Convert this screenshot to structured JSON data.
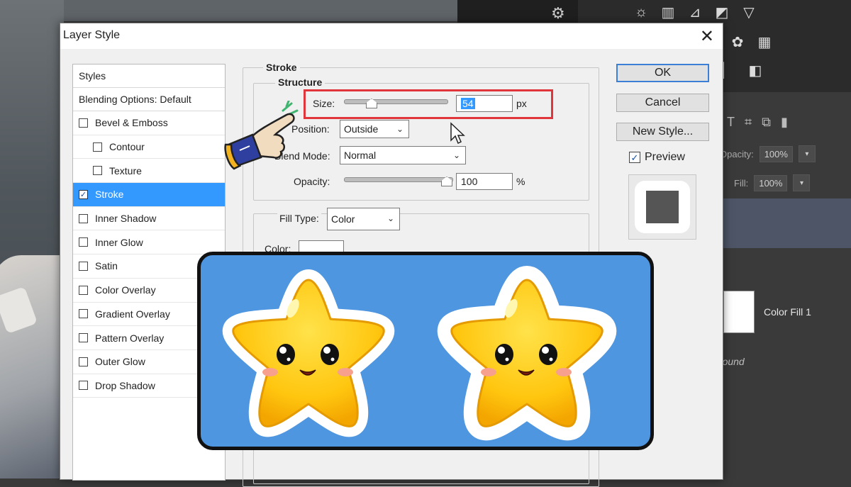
{
  "dialog": {
    "title": "Layer Style",
    "close_glyph": "✕"
  },
  "styles_panel": {
    "header": "Styles",
    "blending_options": "Blending Options: Default",
    "items": [
      {
        "label": "Bevel & Emboss",
        "checked": false,
        "sub": false
      },
      {
        "label": "Contour",
        "checked": false,
        "sub": true
      },
      {
        "label": "Texture",
        "checked": false,
        "sub": true
      },
      {
        "label": "Stroke",
        "checked": true,
        "sub": false,
        "selected": true
      },
      {
        "label": "Inner Shadow",
        "checked": false,
        "sub": false
      },
      {
        "label": "Inner Glow",
        "checked": false,
        "sub": false
      },
      {
        "label": "Satin",
        "checked": false,
        "sub": false
      },
      {
        "label": "Color Overlay",
        "checked": false,
        "sub": false
      },
      {
        "label": "Gradient Overlay",
        "checked": false,
        "sub": false
      },
      {
        "label": "Pattern Overlay",
        "checked": false,
        "sub": false
      },
      {
        "label": "Outer Glow",
        "checked": false,
        "sub": false
      },
      {
        "label": "Drop Shadow",
        "checked": false,
        "sub": false
      }
    ]
  },
  "stroke": {
    "section_title": "Stroke",
    "structure_title": "Structure",
    "size_label": "Size:",
    "size_value": "54",
    "size_unit": "px",
    "position_label": "Position:",
    "position_value": "Outside",
    "blend_mode_label": "Blend Mode:",
    "blend_mode_value": "Normal",
    "opacity_label": "Opacity:",
    "opacity_value": "100",
    "opacity_unit": "%",
    "fill_type_label": "Fill Type:",
    "fill_type_value": "Color",
    "color_label": "Color:"
  },
  "buttons": {
    "ok": "OK",
    "cancel": "Cancel",
    "new_style": "New Style...",
    "preview": "Preview",
    "preview_checked": true
  },
  "ps_panel": {
    "opacity_label": "Opacity:",
    "opacity_value": "100%",
    "fill_label": "Fill:",
    "fill_value": "100%",
    "layer_name": "Color Fill 1",
    "background_layer": "Background"
  },
  "colors": {
    "accent": "#3399ff",
    "highlight_box": "#e0353b",
    "card_bg": "#4f96e0",
    "star_yellow": "#ffcc11"
  }
}
